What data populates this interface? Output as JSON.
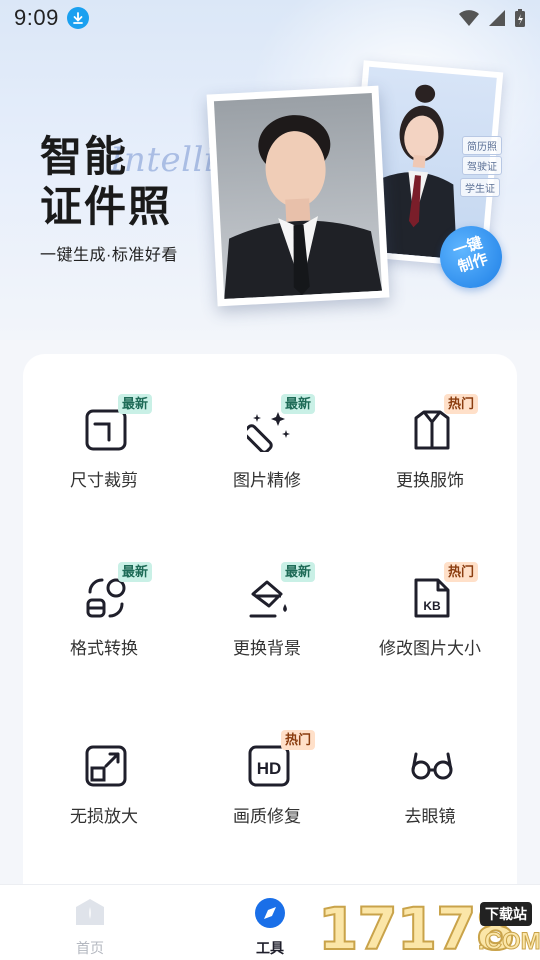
{
  "status_bar": {
    "time": "9:09"
  },
  "hero": {
    "title_line1": "智能",
    "title_line2": "证件照",
    "script_text": "Intelligent",
    "subtitle": "一键生成·标准好看",
    "photo_tags": [
      "简历照",
      "驾驶证",
      "学生证"
    ],
    "oneclick_line1": "一键",
    "oneclick_line2": "制作"
  },
  "tools": [
    {
      "label": "尺寸裁剪",
      "badge": "最新",
      "badge_type": "new",
      "icon": "crop-icon"
    },
    {
      "label": "图片精修",
      "badge": "最新",
      "badge_type": "new",
      "icon": "magic-wand-icon"
    },
    {
      "label": "更换服饰",
      "badge": "热门",
      "badge_type": "hot",
      "icon": "shirt-icon"
    },
    {
      "label": "格式转换",
      "badge": "最新",
      "badge_type": "new",
      "icon": "format-convert-icon"
    },
    {
      "label": "更换背景",
      "badge": "最新",
      "badge_type": "new",
      "icon": "paint-bucket-icon"
    },
    {
      "label": "修改图片大小",
      "badge": "热门",
      "badge_type": "hot",
      "icon": "kb-file-icon",
      "icon_text": "KB"
    },
    {
      "label": "无损放大",
      "badge": "",
      "badge_type": "",
      "icon": "enlarge-icon"
    },
    {
      "label": "画质修复",
      "badge": "热门",
      "badge_type": "hot",
      "icon": "hd-icon",
      "icon_text": "HD"
    },
    {
      "label": "去眼镜",
      "badge": "",
      "badge_type": "",
      "icon": "glasses-icon"
    }
  ],
  "bottom_nav": {
    "home": "首页",
    "tools": "工具",
    "active": "tools",
    "active_color": "#1a6fe8"
  },
  "watermark": {
    "number": "17178",
    "tag": "下载站",
    "suffix": ".COM"
  }
}
